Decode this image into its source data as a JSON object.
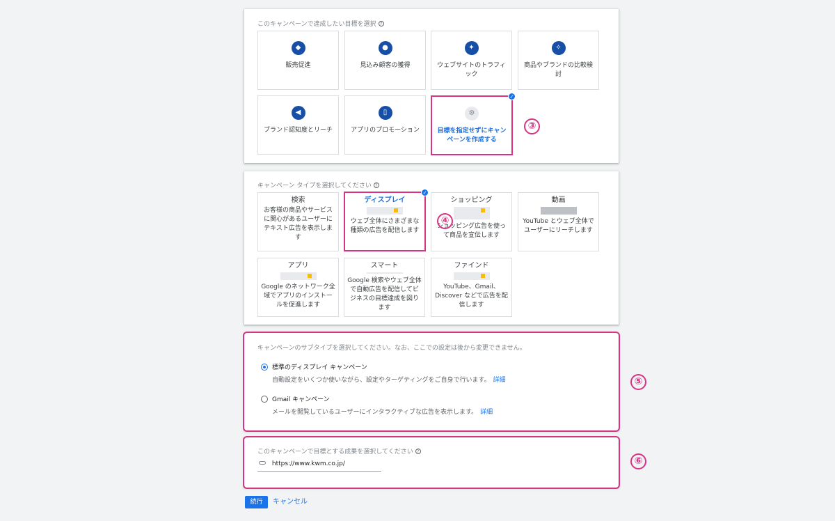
{
  "goal_section": {
    "title": "このキャンペーンで達成したい目標を選択",
    "tiles": [
      {
        "label": "販売促進",
        "icon": "tag-icon"
      },
      {
        "label": "見込み顧客の獲得",
        "icon": "people-icon"
      },
      {
        "label": "ウェブサイトのトラフィック",
        "icon": "cursor-click-icon"
      },
      {
        "label": "商品やブランドの比較検討",
        "icon": "sparkle-icon"
      },
      {
        "label": "ブランド認知度とリーチ",
        "icon": "megaphone-icon"
      },
      {
        "label": "アプリのプロモーション",
        "icon": "phone-icon"
      },
      {
        "label": "目標を指定せずにキャンペーンを作成する",
        "icon": "gear-icon"
      }
    ],
    "selected_index": 6
  },
  "type_section": {
    "title": "キャンペーン タイプを選択してください",
    "tiles": [
      {
        "name": "検索",
        "desc": "お客様の商品やサービスに関心があるユーザーにテキスト広告を表示します"
      },
      {
        "name": "ディスプレイ",
        "desc": "ウェブ全体にさまざまな種類の広告を配信します"
      },
      {
        "name": "ショッピング",
        "desc": "ショッピング広告を使って商品を宣伝します"
      },
      {
        "name": "動画",
        "desc": "YouTube とウェブ全体でユーザーにリーチします"
      },
      {
        "name": "アプリ",
        "desc": "Google のネットワーク全域でアプリのインストールを促進します"
      },
      {
        "name": "スマート",
        "desc": "Google 検索やウェブ全体で自動広告を配信してビジネスの目標達成を図ります"
      },
      {
        "name": "ファインド",
        "desc": "YouTube、Gmail、Discover などで広告を配信します"
      }
    ],
    "selected_index": 1
  },
  "subtype_section": {
    "title": "キャンペーンのサブタイプを選択してください。なお、ここでの設定は後から変更できません。",
    "options": [
      {
        "label": "標準のディスプレイ キャンペーン",
        "desc": "自動設定をいくつか使いながら、設定やターゲティングをご自身で行います。",
        "link": "詳細",
        "selected": true
      },
      {
        "label": "Gmail キャンペーン",
        "desc": "メールを閲覧しているユーザーにインタラクティブな広告を表示します。",
        "link": "詳細",
        "selected": false
      }
    ]
  },
  "outcome_section": {
    "title": "このキャンペーンで目標とする成果を選択してください",
    "url": "https://www.kwm.co.jp/"
  },
  "annotations": [
    "③",
    "④",
    "⑤",
    "⑥"
  ],
  "actions": {
    "continue": "続行",
    "cancel": "キャンセル"
  },
  "colors": {
    "accent": "#1a73e8",
    "highlight": "#d63384",
    "icon_bg": "#174ea6"
  }
}
